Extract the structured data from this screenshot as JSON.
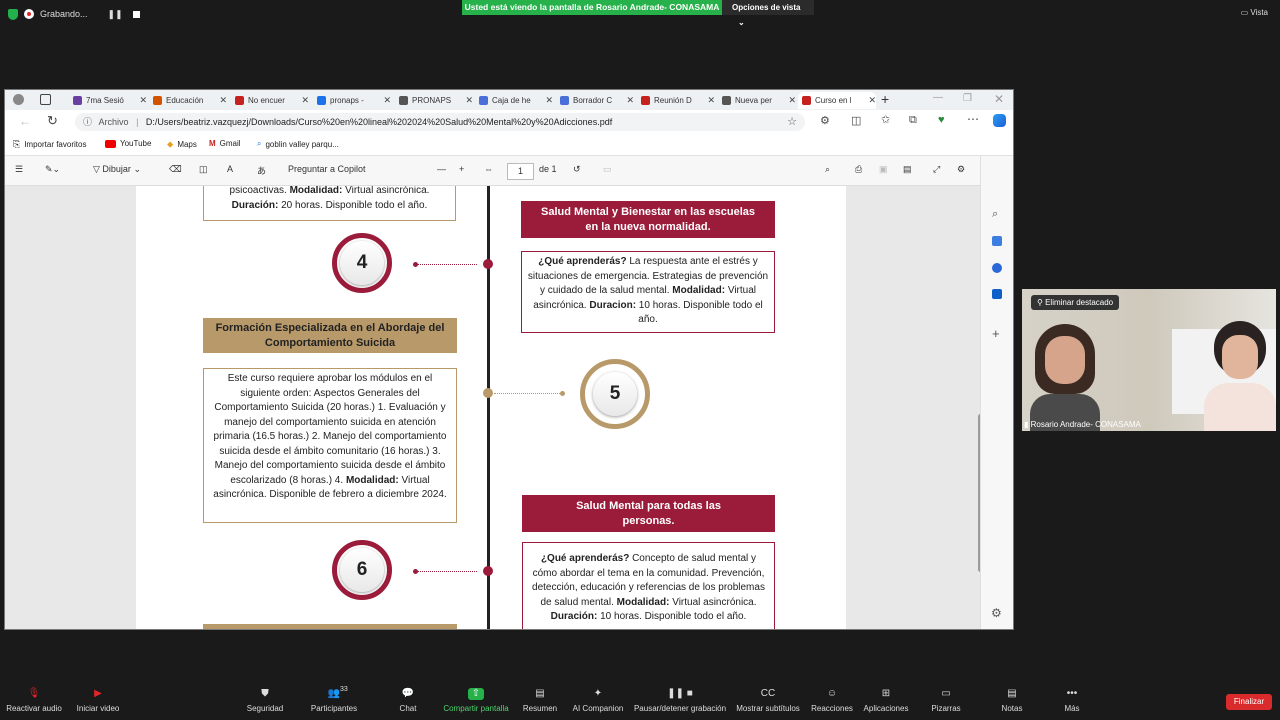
{
  "zoom_top": {
    "recording": "Grabando...",
    "share_banner": "Usted está viendo la pantalla de Rosario Andrade- CONASAMA",
    "view_options": "Opciones de vista",
    "vista": "Vista"
  },
  "browser": {
    "tabs": [
      {
        "label": "7ma Sesió",
        "color": "#6b3fa0"
      },
      {
        "label": "Educación",
        "color": "#d35400"
      },
      {
        "label": "No encuer",
        "color": "#c5221f"
      },
      {
        "label": "pronaps -",
        "color": "#1a73e8"
      },
      {
        "label": "PRONAPS",
        "color": "#555555"
      },
      {
        "label": "Caja de he",
        "color": "#4a6fd8"
      },
      {
        "label": "Borrador C",
        "color": "#4a6fd8"
      },
      {
        "label": "Reunión D",
        "color": "#c5221f"
      },
      {
        "label": "Nueva per",
        "color": "#555555"
      },
      {
        "label": "Curso en l",
        "color": "#c5221f"
      }
    ],
    "address_prefix": "Archivo",
    "url": "D:/Users/beatriz.vazquezj/Downloads/Curso%20en%20lineal%202024%20Salud%20Mental%20y%20Adicciones.pdf",
    "bookmarks": [
      "Importar favoritos",
      "YouTube",
      "Maps",
      "Gmail",
      "goblin valley parqu..."
    ],
    "pdf_toolbar": {
      "draw": "Dibujar",
      "copilot": "Preguntar a Copilot",
      "page": "1",
      "of": "de 1"
    }
  },
  "pdf": {
    "top_box": {
      "line1_pre": "psicoactivas. ",
      "line1_b": "Modalidad:",
      "line1_post": " Virtual asincrónica.",
      "line2_b": "Duración:",
      "line2_post": " 20 horas. Disponible todo el año."
    },
    "step4": "4",
    "step5": "5",
    "step6": "6",
    "right1_header": "Salud Mental y Bienestar en las escuelas en la nueva normalidad.",
    "right1_body": {
      "q": "¿Qué aprenderás?",
      "text": " La respuesta ante el estrés y situaciones de emergencia. Estrategias de prevención y cuidado de la salud mental. ",
      "m": "Modalidad:",
      "mtext": " Virtual asincrónica. ",
      "d": "Duracion:",
      "dtext": " 10 horas. Disponible todo el año."
    },
    "left_header": "Formación Especializada en el Abordaje del Comportamiento Suicida",
    "left_body": {
      "text": "Este curso requiere aprobar los módulos en el siguiente orden: Aspectos Generales del Comportamiento Suicida (20 horas.) 1. Evaluación y manejo del comportamiento suicida en atención primaria (16.5 horas.) 2. Manejo del comportamiento suicida desde el ámbito comunitario (16 horas.) 3. Manejo del comportamiento suicida desde el ámbito escolarizado (8 horas.) 4. ",
      "m": "Modalidad:",
      "mtext": " Virtual asincrónica. Disponible de febrero a diciembre 2024."
    },
    "right2_header": "Salud Mental para todas las personas.",
    "right2_body": {
      "q": "¿Qué aprenderás?",
      "text": " Concepto de salud mental y cómo abordar el tema en la comunidad. Prevención, detección, educación y referencias de los problemas de salud mental. ",
      "m": "Modalidad:",
      "mtext": " Virtual asincrónica.",
      "d": "Duración:",
      "dtext": " 10 horas. Disponible todo el año."
    },
    "colors": {
      "maroon": "#9b1b3a",
      "gold": "#b8996a"
    }
  },
  "video": {
    "pin_label": "Eliminar destacado",
    "name": "Rosario Andrade- CONASAMA"
  },
  "zoom_toolbar": {
    "items": [
      {
        "label": "Reactivar audio",
        "icon": "mic-muted-icon"
      },
      {
        "label": "Iniciar video",
        "icon": "video-off-icon"
      },
      {
        "label": "Seguridad",
        "icon": "shield-icon"
      },
      {
        "label": "Participantes",
        "icon": "participants-icon",
        "count": "33"
      },
      {
        "label": "Chat",
        "icon": "chat-icon"
      },
      {
        "label": "Compartir pantalla",
        "icon": "share-screen-icon"
      },
      {
        "label": "Resumen",
        "icon": "summary-icon"
      },
      {
        "label": "AI Companion",
        "icon": "ai-companion-icon"
      },
      {
        "label": "Pausar/detener grabación",
        "icon": "pause-stop-icon"
      },
      {
        "label": "Mostrar subtítulos",
        "icon": "captions-icon"
      },
      {
        "label": "Reacciones",
        "icon": "reactions-icon"
      },
      {
        "label": "Aplicaciones",
        "icon": "apps-icon"
      },
      {
        "label": "Pizarras",
        "icon": "whiteboard-icon"
      },
      {
        "label": "Notas",
        "icon": "notes-icon"
      },
      {
        "label": "Más",
        "icon": "more-icon"
      }
    ],
    "end": "Finalizar"
  }
}
